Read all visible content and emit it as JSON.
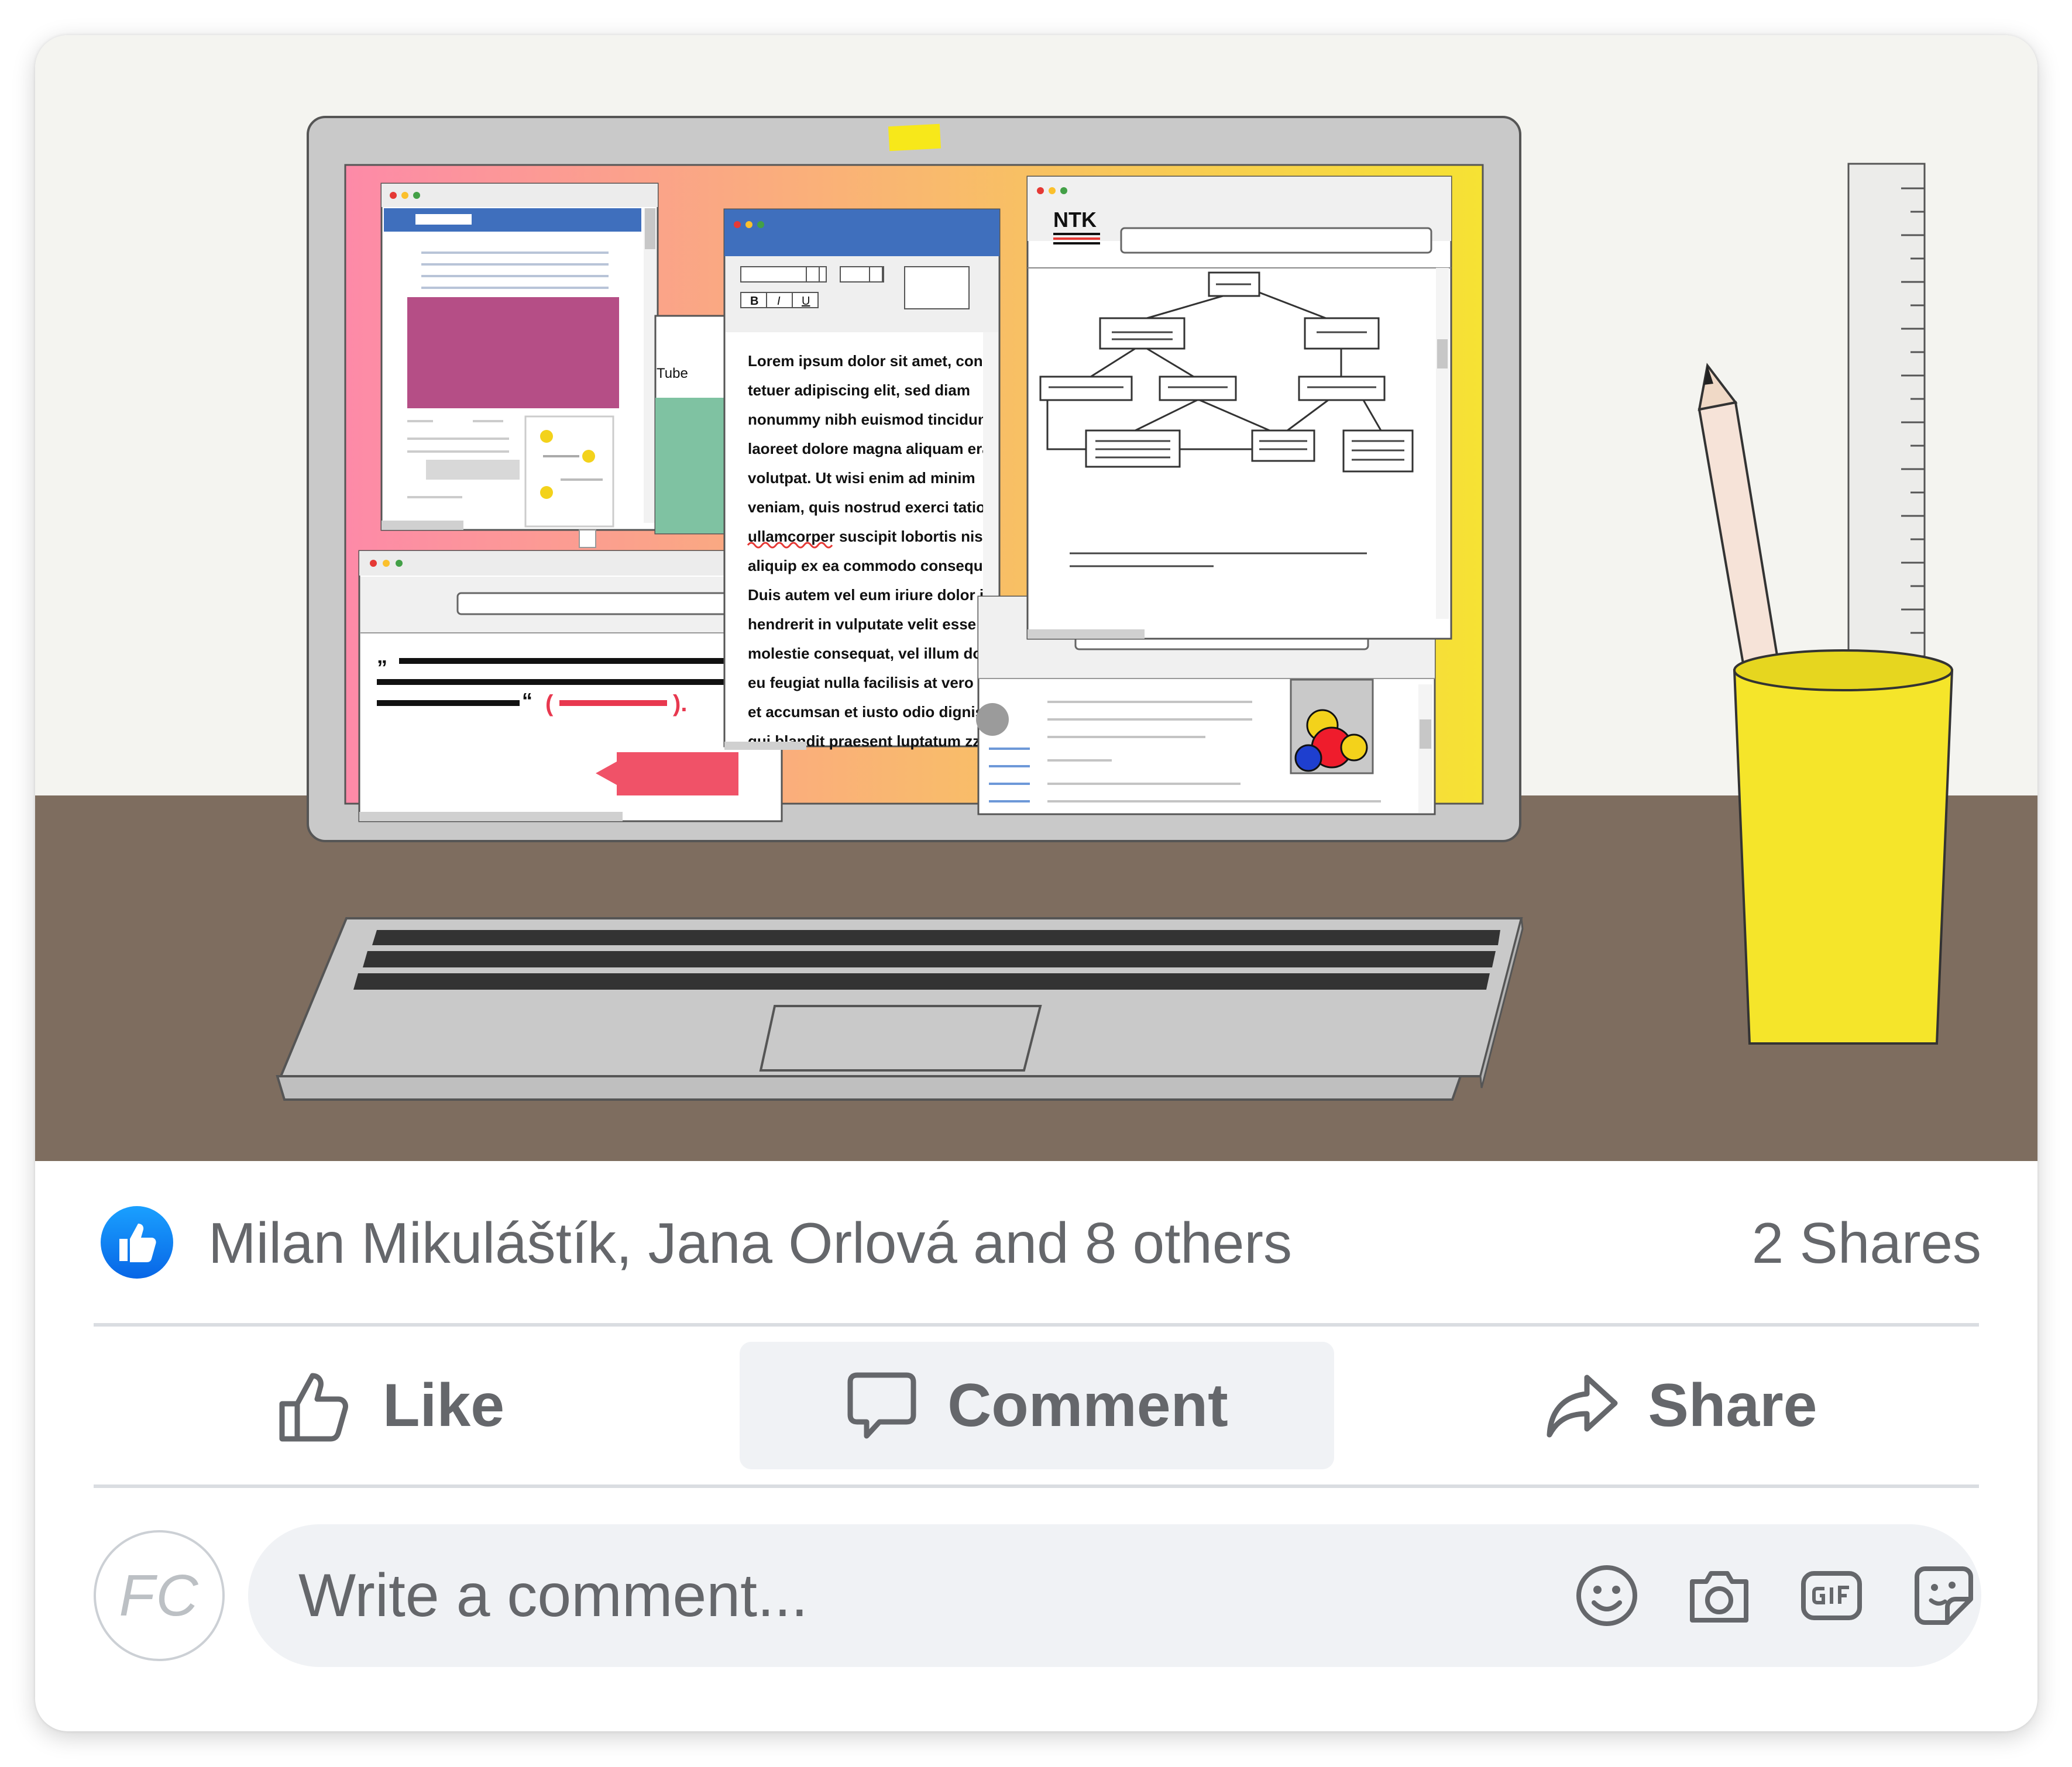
{
  "illustration": {
    "colors": {
      "wall": "#f4f4f0",
      "desk": "#7e6d5f",
      "laptop": "#c9c9c9",
      "screen_gradient": [
        "#fd8aa8",
        "#f9b86f",
        "#f6e233"
      ],
      "cup": "#f5e52a"
    },
    "browser_tab_label": "Tube",
    "document_toolbar": {
      "bold": "B",
      "italic": "I",
      "underline": "U"
    },
    "document_lines": [
      "Lorem ipsum dolor sit amet, cons",
      "tetuer adipiscing elit, sed diam",
      "nonummy nibh euismod tincidun",
      "laoreet dolore magna aliquam era",
      "volutpat. Ut wisi enim ad minim",
      "veniam, quis nostrud exerci tation",
      "ullamcorper suscipit lobortis nisl",
      "aliquip ex ea commodo consequa",
      "Duis autem vel eum iriure dolor in",
      "hendrerit in vulputate velit esse",
      "molestie consequat, vel illum dol",
      "eu feugiat nulla facilisis at vero er",
      "et accumsan et iusto odio digniss",
      "qui blandit praesent luptatum zzr"
    ],
    "diagram_logo": "NTK",
    "quote_open": "”",
    "quote_close": "“",
    "citation_left": "(",
    "citation_right": ")."
  },
  "stats": {
    "reactors": "Milan Mikuláštík, Jana Orlová and 8 others",
    "shares": "2 Shares",
    "reaction_icon": "thumbs-up-icon",
    "reaction_color": "#0866ff"
  },
  "actions": {
    "like": {
      "label": "Like",
      "icon": "thumbs-up-outline-icon"
    },
    "comment": {
      "label": "Comment",
      "icon": "speech-bubble-icon"
    },
    "share": {
      "label": "Share",
      "icon": "share-arrow-icon"
    }
  },
  "composer": {
    "avatar_initials": "FC",
    "placeholder": "Write a comment...",
    "icons": [
      "emoji-icon",
      "camera-icon",
      "gif-icon",
      "sticker-icon"
    ]
  }
}
